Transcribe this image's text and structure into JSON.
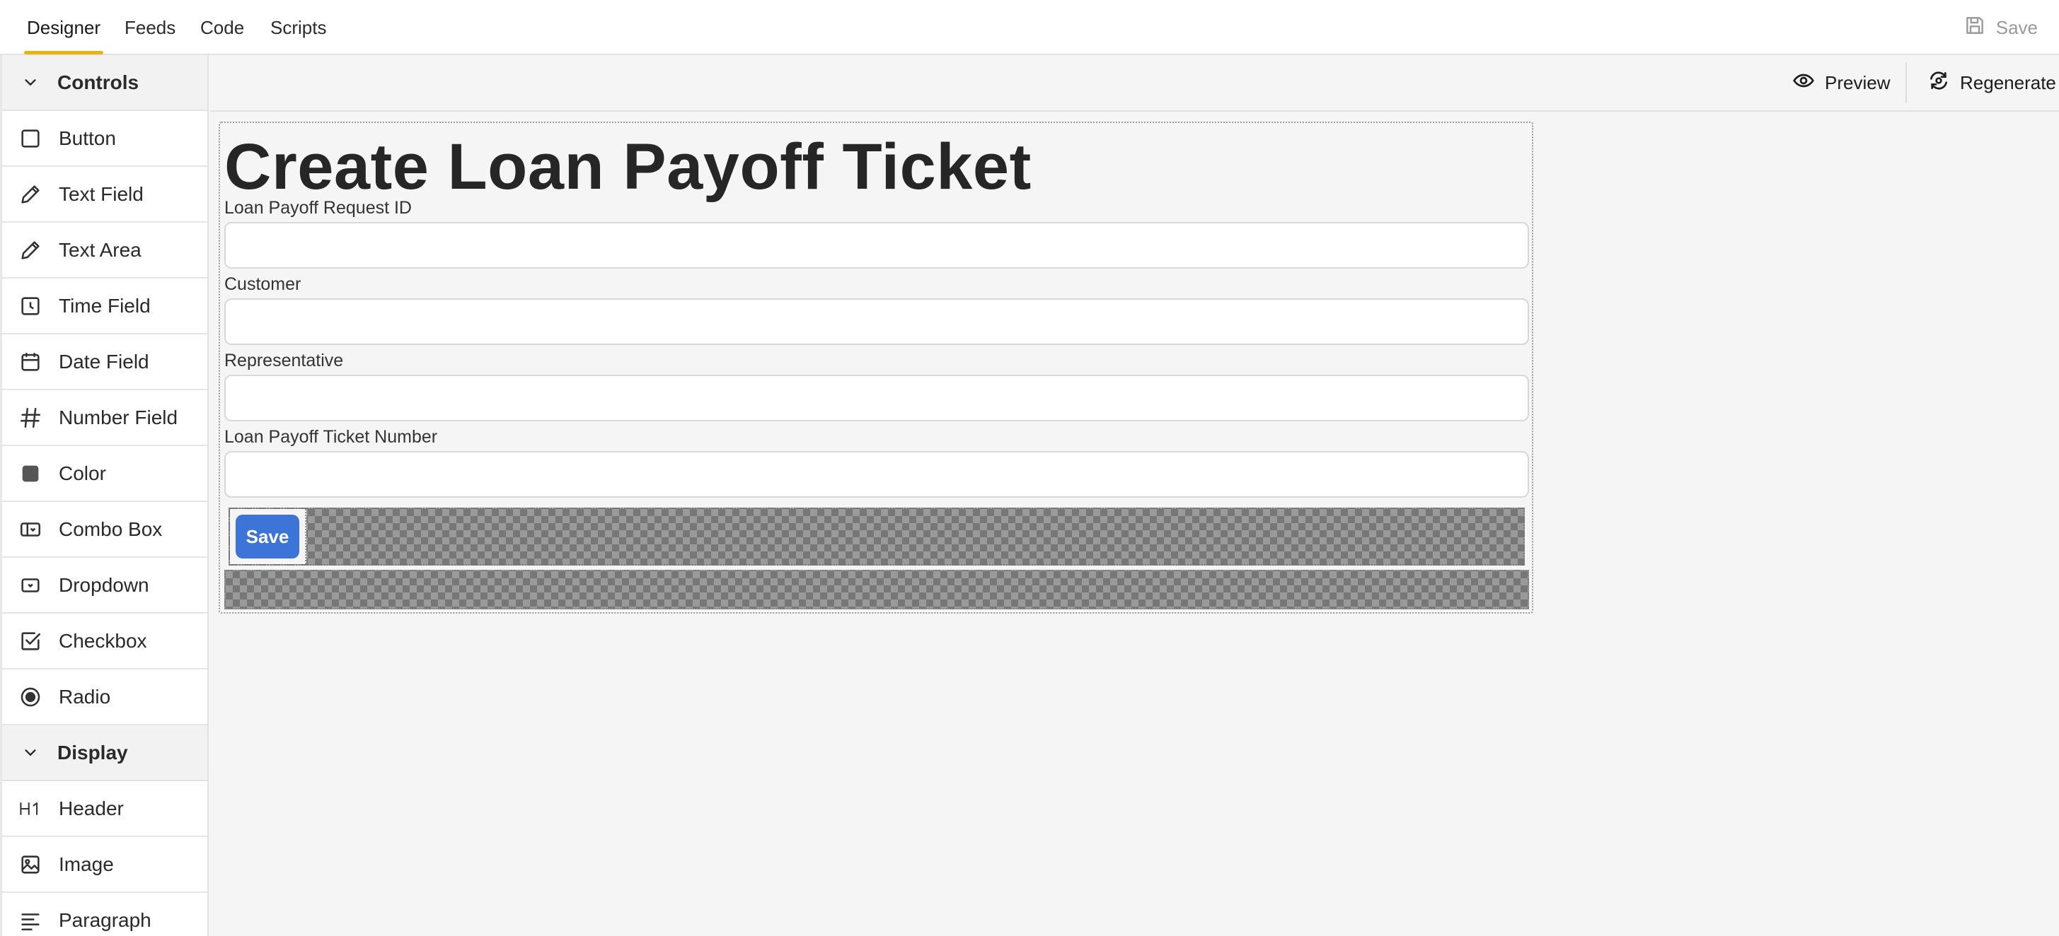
{
  "tabs": [
    {
      "label": "Designer",
      "active": true
    },
    {
      "label": "Feeds",
      "active": false
    },
    {
      "label": "Code",
      "active": false
    },
    {
      "label": "Scripts",
      "active": false
    }
  ],
  "header_save_label": "Save",
  "toolbar": {
    "preview_label": "Preview",
    "regenerate_label": "Regenerate"
  },
  "sidebar": {
    "controls_section": "Controls",
    "controls": [
      {
        "label": "Button",
        "icon": "button-icon"
      },
      {
        "label": "Text Field",
        "icon": "pencil-icon"
      },
      {
        "label": "Text Area",
        "icon": "pencil-icon"
      },
      {
        "label": "Time Field",
        "icon": "clock-icon"
      },
      {
        "label": "Date Field",
        "icon": "calendar-icon"
      },
      {
        "label": "Number Field",
        "icon": "hash-icon"
      },
      {
        "label": "Color",
        "icon": "color-swatch-icon"
      },
      {
        "label": "Combo Box",
        "icon": "combo-box-icon"
      },
      {
        "label": "Dropdown",
        "icon": "dropdown-icon"
      },
      {
        "label": "Checkbox",
        "icon": "checkbox-icon"
      },
      {
        "label": "Radio",
        "icon": "radio-icon"
      }
    ],
    "display_section": "Display",
    "display": [
      {
        "label": "Header",
        "icon": "h1-icon"
      },
      {
        "label": "Image",
        "icon": "image-icon"
      },
      {
        "label": "Paragraph",
        "icon": "paragraph-icon"
      }
    ]
  },
  "form": {
    "title": "Create Loan Payoff Ticket",
    "fields": [
      {
        "label": "Loan Payoff Request ID",
        "value": ""
      },
      {
        "label": "Customer",
        "value": ""
      },
      {
        "label": "Representative",
        "value": ""
      },
      {
        "label": "Loan Payoff Ticket Number",
        "value": ""
      }
    ],
    "save_button_label": "Save"
  },
  "colors": {
    "active_tab_underline": "#e8b50e",
    "primary_button": "#3c74d8"
  }
}
